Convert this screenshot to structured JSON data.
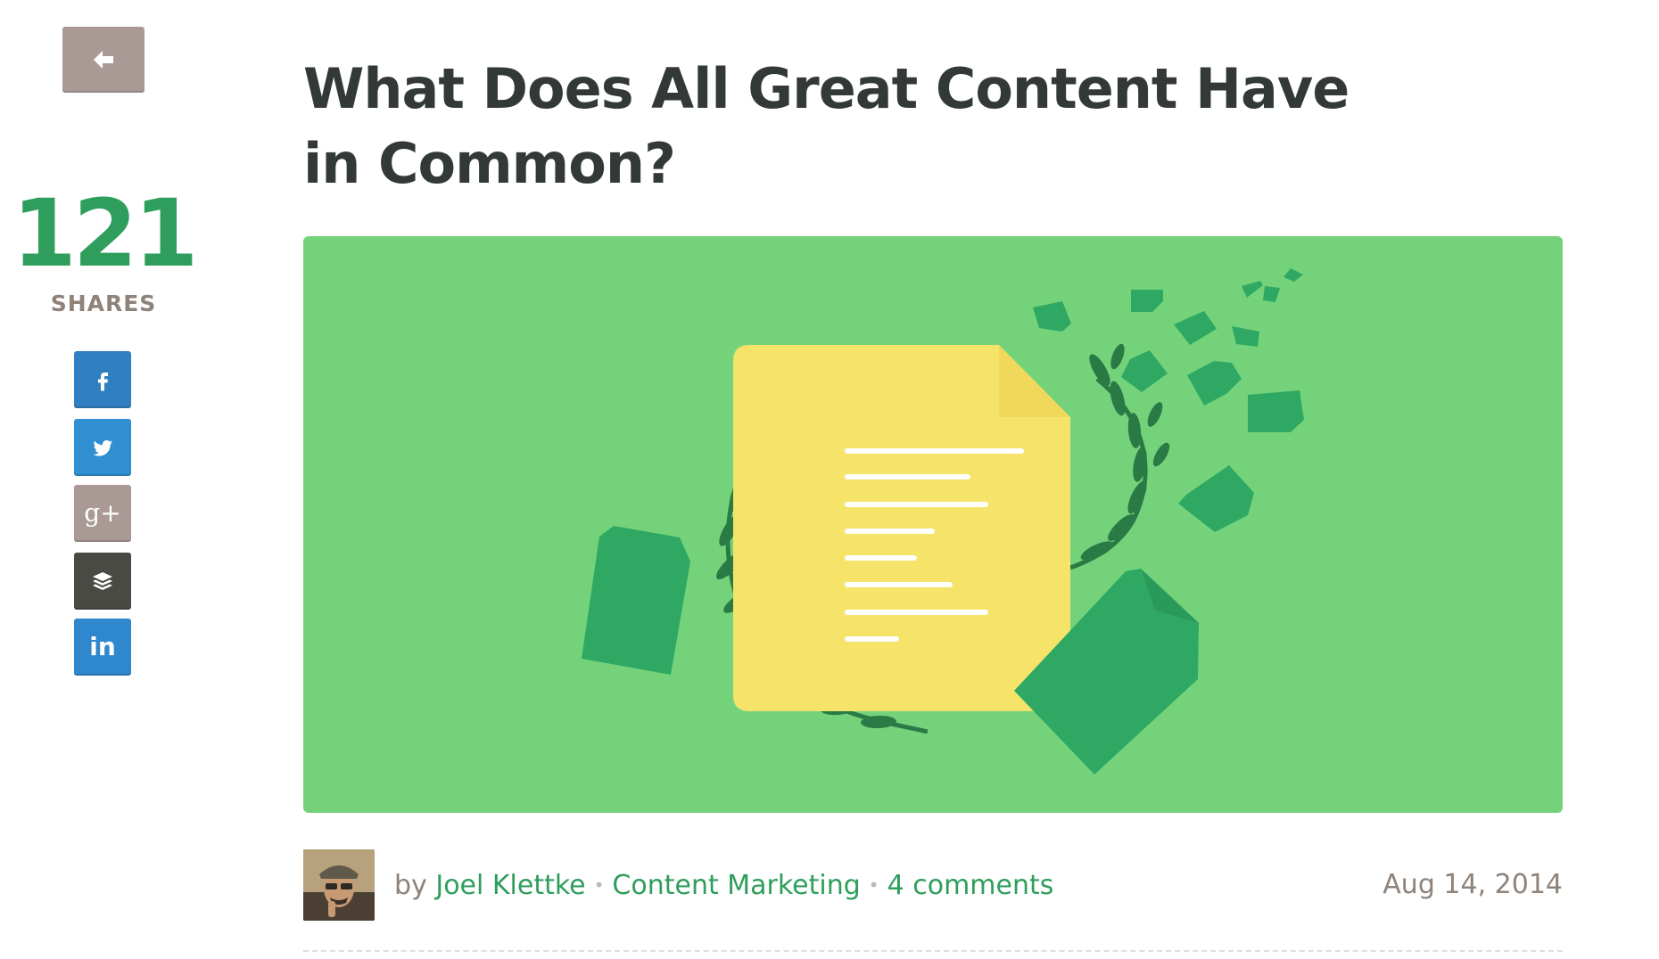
{
  "share_rail": {
    "count": "121",
    "label": "SHARES",
    "icons": {
      "back": "arrow-left-icon",
      "facebook": "facebook-icon",
      "twitter": "twitter-icon",
      "google_plus": "google-plus-icon",
      "buffer": "buffer-icon",
      "linkedin": "linkedin-icon"
    },
    "google_plus_glyph": "g+",
    "linkedin_glyph": "in"
  },
  "article": {
    "title": "What Does All Great Content Have in Common?",
    "meta": {
      "by_prefix": "by",
      "author": "Joel Klettke",
      "category": "Content Marketing",
      "comments": "4 comments",
      "date": "Aug 14, 2014",
      "separator": "•"
    }
  },
  "colors": {
    "accent_green": "#2f9e5c",
    "hero_bg": "#74d37a",
    "document_yellow": "#f5e36a",
    "title_dark": "#333a35",
    "muted": "#8e8279",
    "facebook": "#2f7fc1",
    "twitter": "#2f8fd0",
    "google_plus": "#a99a96",
    "buffer": "#4a4a45",
    "linkedin": "#2f88ce"
  }
}
